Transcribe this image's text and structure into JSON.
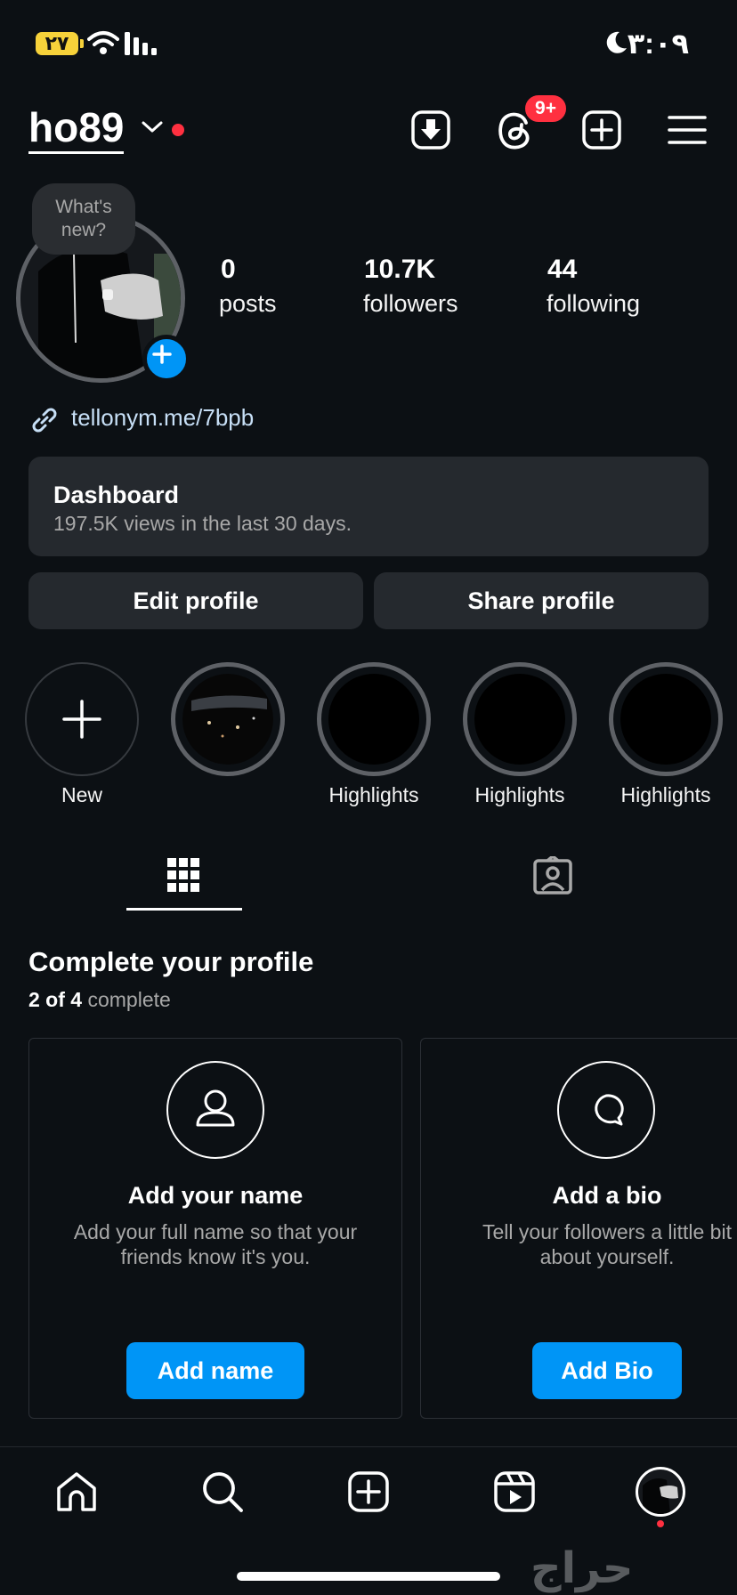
{
  "status_bar": {
    "battery": "٢٧",
    "time": "٣:٠٩"
  },
  "header": {
    "username": "ho89",
    "notifications_badge": "9+"
  },
  "profile": {
    "tooltip": "What's new?",
    "stats": [
      {
        "value": "0",
        "label": "posts"
      },
      {
        "value": "10.7K",
        "label": "followers"
      },
      {
        "value": "44",
        "label": "following"
      }
    ],
    "link": "tellonym.me/7bpb"
  },
  "dashboard": {
    "title": "Dashboard",
    "subtitle": "197.5K views in the last 30 days."
  },
  "buttons": {
    "edit": "Edit profile",
    "share": "Share profile"
  },
  "highlights": [
    {
      "label": "New"
    },
    {
      "label": ""
    },
    {
      "label": "Highlights"
    },
    {
      "label": "Highlights"
    },
    {
      "label": "Highlights"
    }
  ],
  "complete_profile": {
    "title": "Complete your profile",
    "progress": "2 of 4",
    "progress_suffix": "complete",
    "cards": [
      {
        "icon": "person-icon",
        "title": "Add your name",
        "desc": "Add your full name so that your friends know it's you.",
        "button": "Add name"
      },
      {
        "icon": "speech-bubble-icon",
        "title": "Add a bio",
        "desc": "Tell your followers a little bit about yourself.",
        "button": "Add Bio"
      }
    ]
  },
  "watermark": "حراج",
  "colors": {
    "background": "#0c1014",
    "accent": "#0095f6",
    "badge": "#ff3040",
    "surface": "#25292e"
  }
}
